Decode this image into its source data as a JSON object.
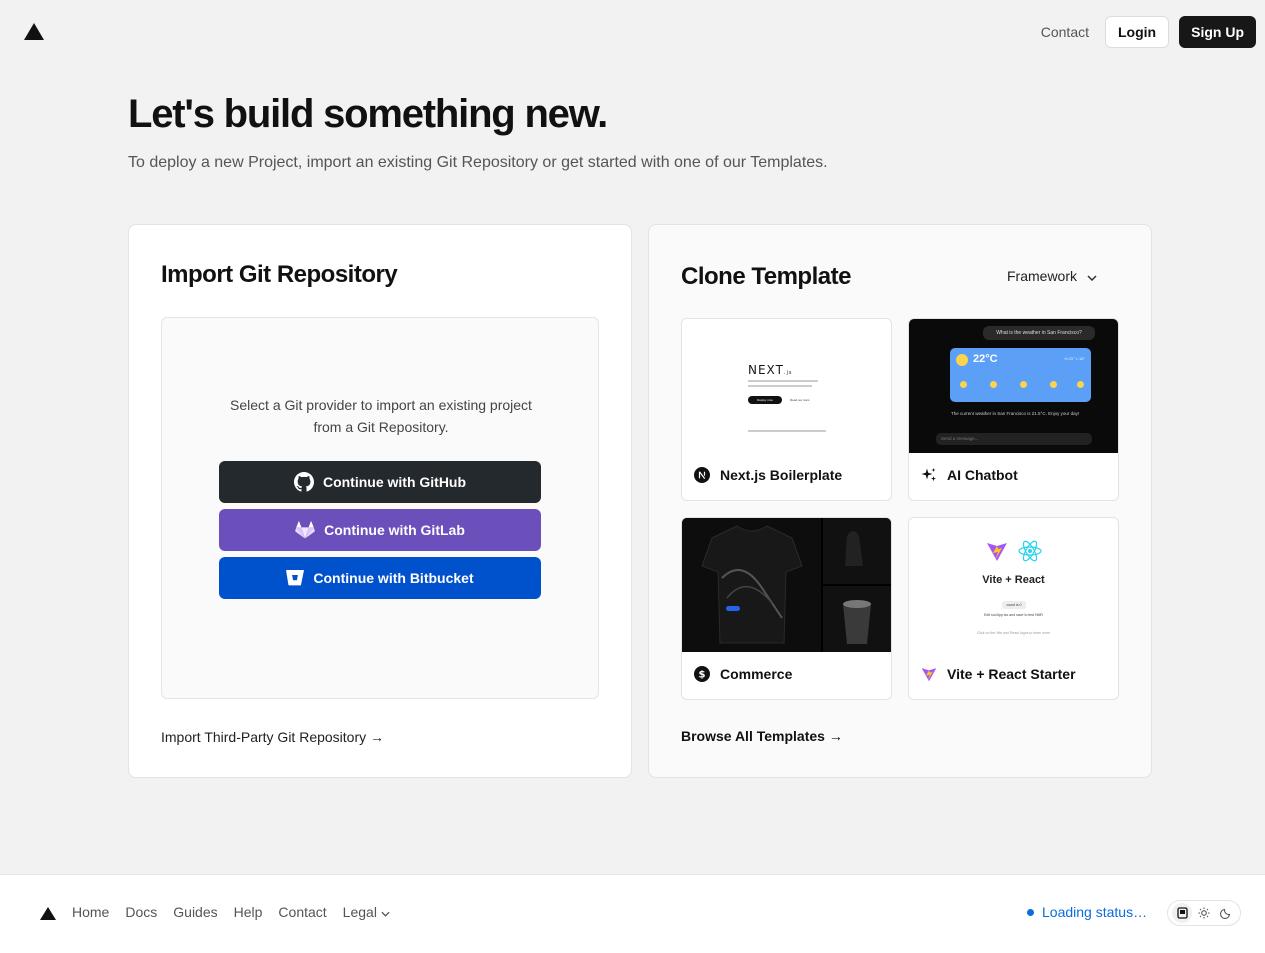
{
  "header": {
    "contact": "Contact",
    "login": "Login",
    "signup": "Sign Up"
  },
  "hero": {
    "title": "Let's build something new.",
    "subtitle": "To deploy a new Project, import an existing Git Repository or get started with one of our Templates."
  },
  "import": {
    "title": "Import Git Repository",
    "prompt": "Select a Git provider to import an existing project from a Git Repository.",
    "github": "Continue with GitHub",
    "gitlab": "Continue with GitLab",
    "bitbucket": "Continue with Bitbucket",
    "third_party": "Import Third-Party Git Repository →"
  },
  "clone": {
    "title": "Clone Template",
    "framework": "Framework",
    "browse": "Browse All Templates →",
    "templates": [
      {
        "label": "Next.js Boilerplate",
        "icon": "nextjs-icon"
      },
      {
        "label": "AI Chatbot",
        "icon": "sparkle-icon"
      },
      {
        "label": "Commerce",
        "icon": "dollar-icon"
      },
      {
        "label": "Vite + React Starter",
        "icon": "vite-icon"
      }
    ],
    "previews": {
      "next_logo": "NEXT",
      "next_sub": ".js",
      "next_btn": "Deploy now",
      "next_btn2": "Read our docs",
      "chat_question": "What is the weather in San Francisco?",
      "chat_temp": "22°C",
      "chat_hilo": "H:23° L:18°",
      "chat_answer": "The current weather in San Francisco is 21.5°C. Enjoy your day!",
      "chat_input": "Send a message...",
      "vite_title": "Vite + React",
      "vite_count": "count is 0",
      "vite_edit": "Edit src/App.tsx and save to test HMR",
      "vite_click": "Click on the Vite and React logos to learn more"
    }
  },
  "footer": {
    "links": [
      "Home",
      "Docs",
      "Guides",
      "Help",
      "Contact"
    ],
    "legal": "Legal",
    "status": "Loading status…"
  },
  "colors": {
    "github": "#24292e",
    "gitlab": "#6b4fbb",
    "bitbucket": "#0052cc",
    "status": "#0a6cdd"
  }
}
